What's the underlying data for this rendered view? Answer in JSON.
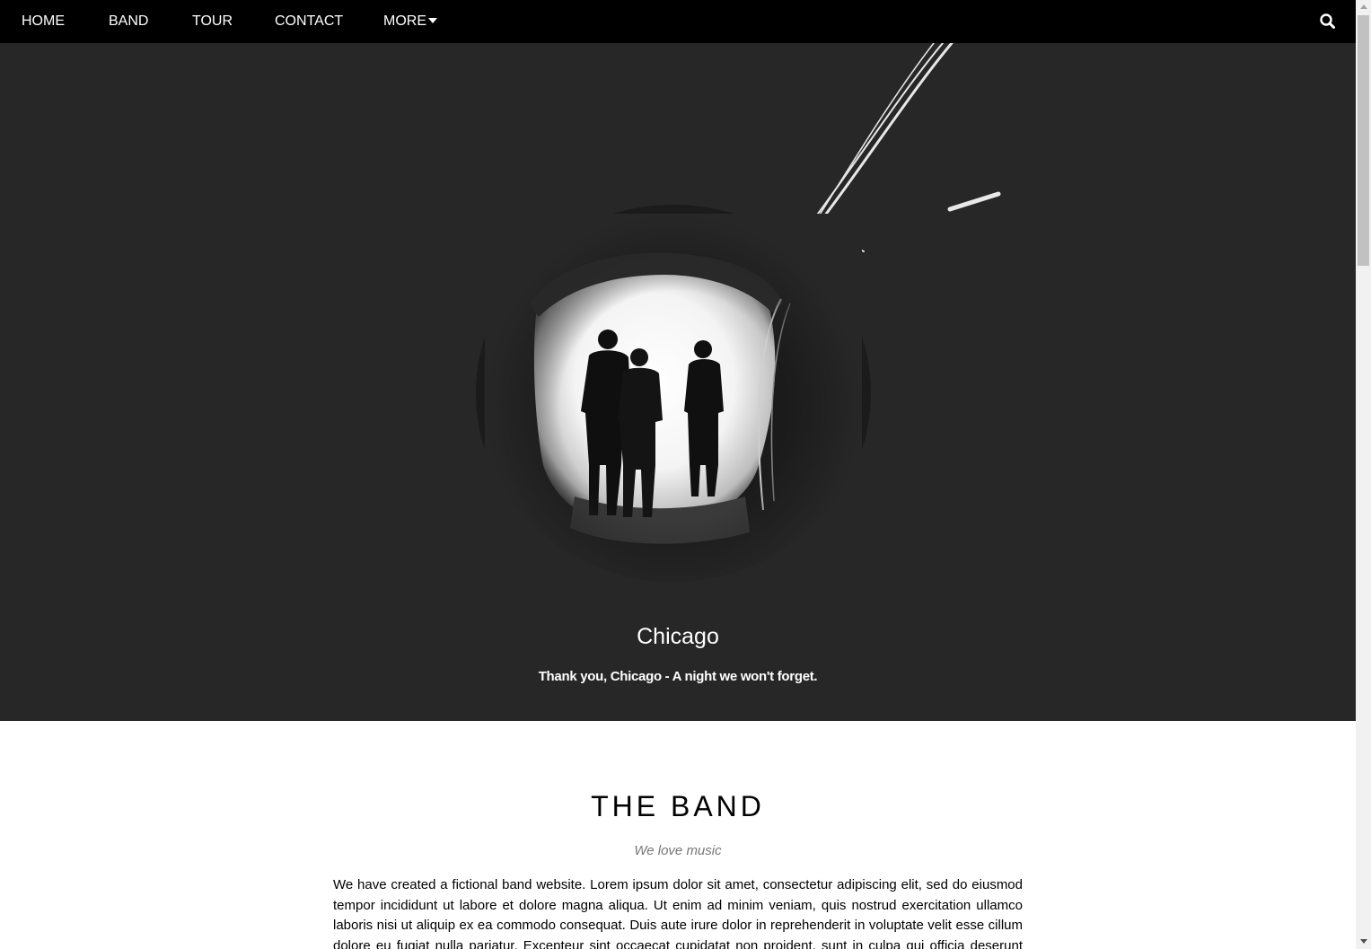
{
  "nav": {
    "home": "HOME",
    "band": "BAND",
    "tour": "TOUR",
    "contact": "CONTACT",
    "more": "MORE",
    "search_icon": "search-icon"
  },
  "hero": {
    "title": "Chicago",
    "subtitle": "Thank you, Chicago - A night we won't forget."
  },
  "band": {
    "heading": "THE BAND",
    "tagline": "We love music",
    "text": "We have created a fictional band website. Lorem ipsum dolor sit amet, consectetur adipiscing elit, sed do eiusmod tempor incididunt ut labore et dolore magna aliqua. Ut enim ad minim veniam, quis nostrud exercitation ullamco laboris nisi ut aliquip ex ea commodo consequat. Duis aute irure dolor in reprehenderit in voluptate velit esse cillum dolore eu fugiat nulla pariatur. Excepteur sint occaecat cupidatat non proident, sunt in culpa qui officia deserunt mollit anim id est laborum."
  },
  "colors": {
    "nav_bg": "#000000",
    "hero_bg": "#272727",
    "text_light": "#ffffff",
    "tagline": "#777777"
  }
}
